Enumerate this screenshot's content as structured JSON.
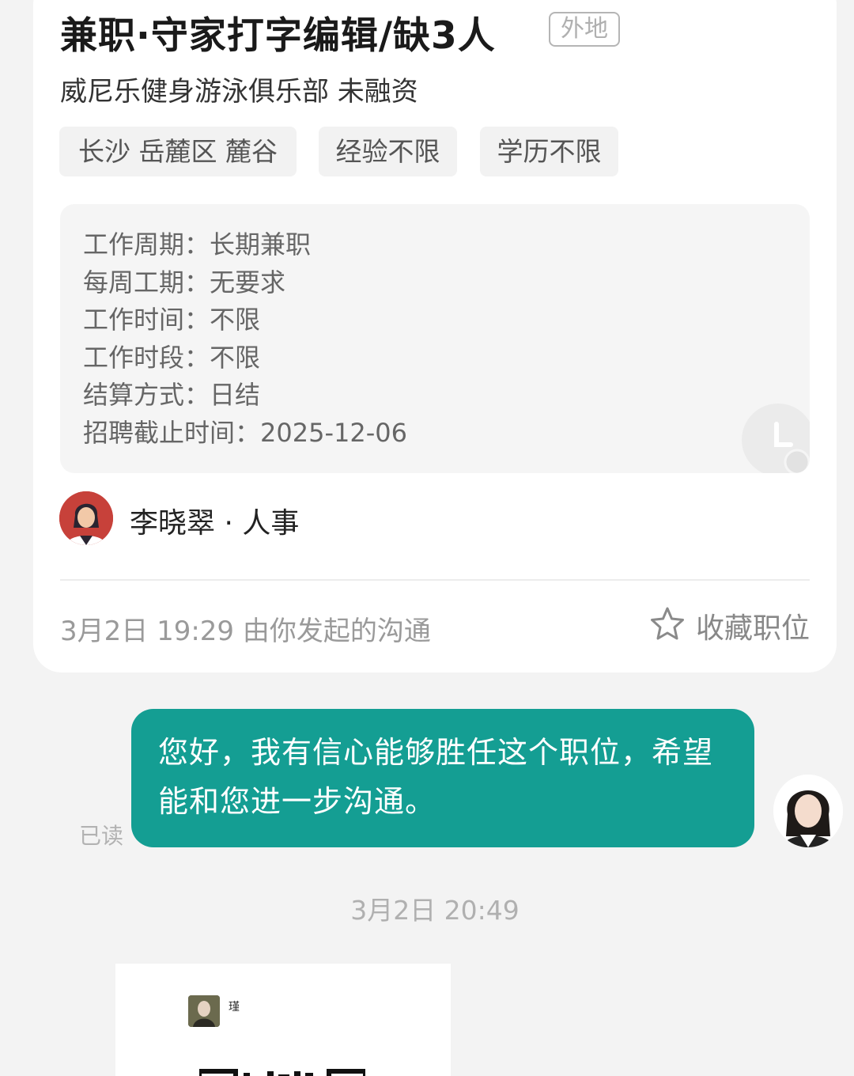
{
  "job": {
    "title": "兼职·守家打字编辑/缺3人",
    "badge": "外地",
    "company": "威尼乐健身游泳俱乐部 未融资",
    "tags": [
      "长沙 岳麓区 麓谷",
      "经验不限",
      "学历不限"
    ],
    "details": [
      "工作周期：长期兼职",
      "每周工期：无要求",
      "工作时间：不限",
      "工作时段：不限",
      "结算方式：日结",
      "招聘截止时间：2025-12-06"
    ]
  },
  "recruiter": {
    "name": "李晓翠 · 人事"
  },
  "meta": {
    "started": "3月2日 19:29 由你发起的沟通",
    "favorite_label": "收藏职位"
  },
  "chat": {
    "message": "您好，我有信心能够胜任这个职位，希望能和您进一步沟通。",
    "read_status": "已读",
    "timestamp": "3月2日 20:49",
    "image_card_name": "瑾"
  },
  "colors": {
    "accent": "#149e93",
    "bubble_text": "#ffffff",
    "background": "#f3f3f3"
  },
  "icons": {
    "favorite": "star-outline-icon",
    "watermark": "clock-icon"
  }
}
